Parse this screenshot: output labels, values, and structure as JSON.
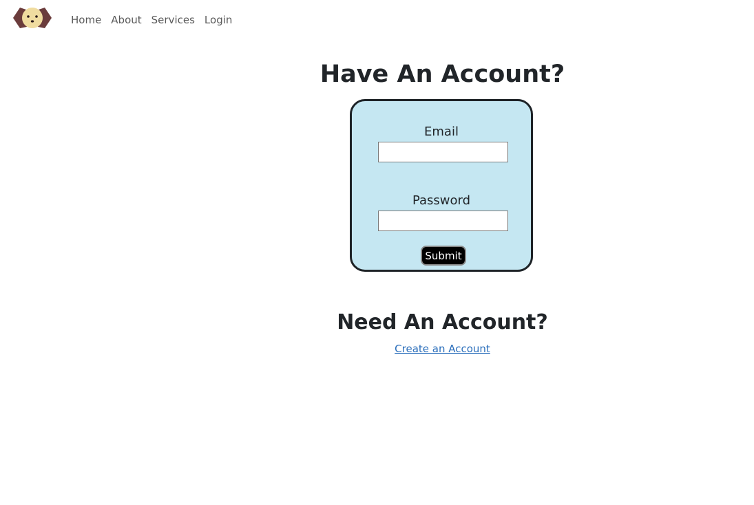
{
  "navbar": {
    "logo_icon": "dog-face-icon",
    "links": [
      "Home",
      "About",
      "Services",
      "Login"
    ]
  },
  "login": {
    "title": "Have An Account?",
    "email_label": "Email",
    "email_value": "",
    "password_label": "Password",
    "password_value": "",
    "submit_label": "Submit"
  },
  "signup": {
    "title": "Need An Account?",
    "link_label": "Create an Account"
  },
  "colors": {
    "box_background": "#c5e7f2",
    "box_border": "#1e2327",
    "dog_ear": "#6b3c3c",
    "dog_face": "#f0dca0",
    "link": "#2a6ebb"
  }
}
